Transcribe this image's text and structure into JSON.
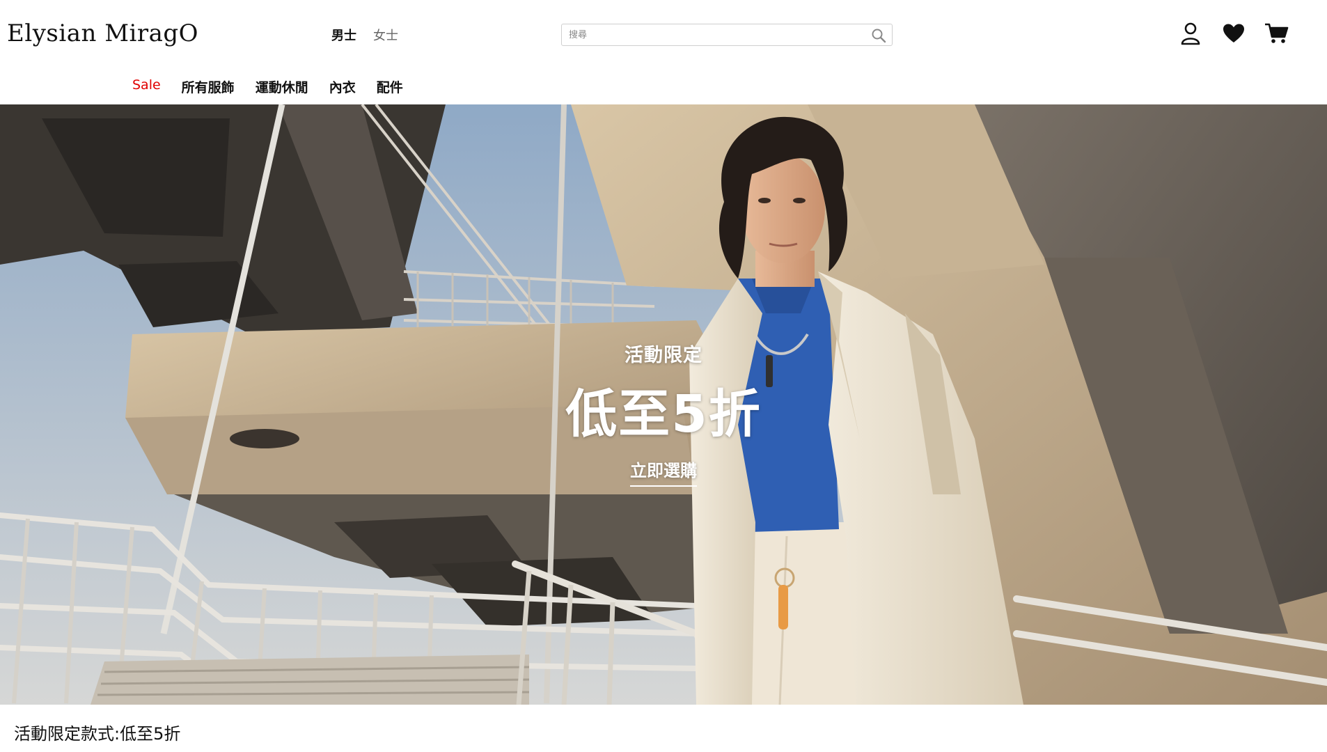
{
  "brand": {
    "logo_text": "Elysian MiragO"
  },
  "gender_nav": {
    "men": "男士",
    "women": "女士"
  },
  "search": {
    "placeholder": "搜尋"
  },
  "category_nav": {
    "sale": "Sale",
    "all_apparel": "所有服飾",
    "sportswear": "運動休閒",
    "underwear": "內衣",
    "accessories": "配件"
  },
  "icons": {
    "account": "user-icon",
    "wishlist": "heart-icon",
    "cart": "cart-icon",
    "search": "search-icon"
  },
  "hero": {
    "subtitle": "活動限定",
    "headline": "低至5折",
    "cta": "立即選購"
  },
  "section": {
    "title": "活動限定款式:低至5折"
  },
  "colors": {
    "sale_red": "#e00000",
    "text_dark": "#111111",
    "shirt_blue": "#2f5fb3",
    "jacket_cream": "#ece3d2"
  }
}
